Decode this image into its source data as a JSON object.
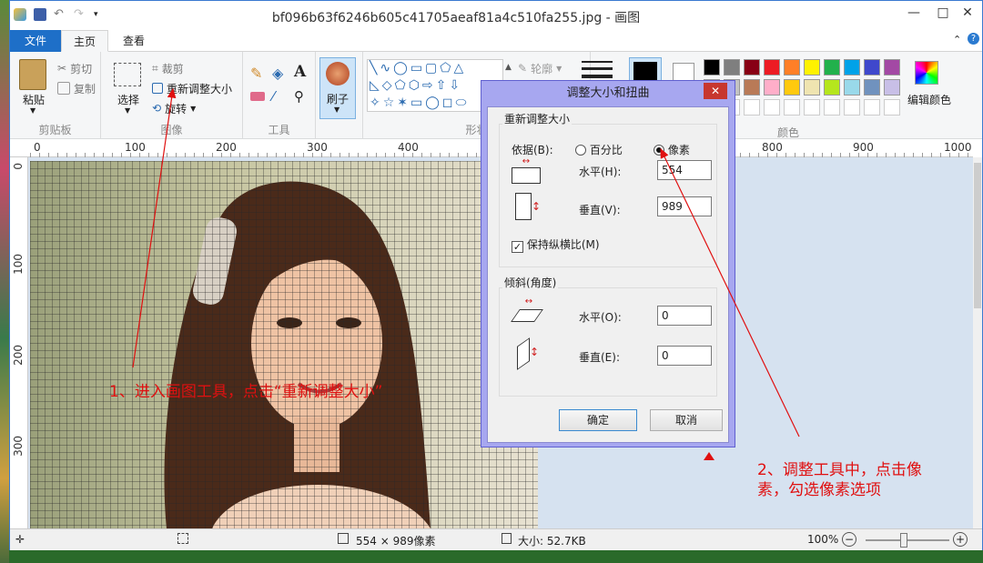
{
  "window": {
    "title": "bf096b63f6246b605c41705aeaf81a4c510fa255.jpg - 画图",
    "minimize": "—",
    "maximize": "□",
    "close": "✕"
  },
  "tabs": {
    "file": "文件",
    "home": "主页",
    "view": "查看"
  },
  "ribbon": {
    "clipboard": {
      "paste": "粘贴",
      "cut": "剪切",
      "copy": "复制",
      "label": "剪贴板"
    },
    "image": {
      "select": "选择",
      "crop": "裁剪",
      "resize": "重新调整大小",
      "rotate": "旋转",
      "label": "图像"
    },
    "tools": {
      "label": "工具"
    },
    "brushes": {
      "label": "刷子"
    },
    "shapes": {
      "outline": "轮廓",
      "label": "形状"
    },
    "colors": {
      "edit": "编辑颜色",
      "label": "颜色",
      "palette_row1": [
        "#000000",
        "#7f7f7f",
        "#880015",
        "#ed1c24",
        "#ff7f27",
        "#fff200",
        "#22b14c",
        "#00a2e8",
        "#3f48cc",
        "#a349a4"
      ],
      "palette_row2": [
        "#ffffff",
        "#c3c3c3",
        "#b97a57",
        "#ffaec9",
        "#ffc90e",
        "#efe4b0",
        "#b5e61d",
        "#99d9ea",
        "#7092be",
        "#c8bfe7"
      ]
    }
  },
  "ruler": {
    "h": [
      "0",
      "100",
      "200",
      "300",
      "400",
      "800",
      "900",
      "1000"
    ],
    "v": [
      "0",
      "100",
      "200",
      "300"
    ]
  },
  "dialog": {
    "title": "调整大小和扭曲",
    "resize_group": "重新调整大小",
    "by_label": "依据(B):",
    "percent": "百分比",
    "pixels": "像素",
    "horizontal_label": "水平(H):",
    "horizontal_value": "554",
    "vertical_label": "垂直(V):",
    "vertical_value": "989",
    "keep_ratio": "保持纵横比(M)",
    "skew_group": "倾斜(角度)",
    "skew_h_label": "水平(O):",
    "skew_h_value": "0",
    "skew_v_label": "垂直(E):",
    "skew_v_value": "0",
    "ok": "确定",
    "cancel": "取消"
  },
  "annotations": {
    "note1": "1、进入画图工具，点击“重新调整大小”",
    "note2_line1": "2、调整工具中，点击像",
    "note2_line2": "素，勾选像素选项"
  },
  "status": {
    "dimensions": "554 × 989像素",
    "size": "大小: 52.7KB",
    "zoom": "100%"
  },
  "colors": {
    "accent": "#1e6fc8",
    "dialog_frame": "#a7a7f0",
    "annotation": "#e01010"
  }
}
